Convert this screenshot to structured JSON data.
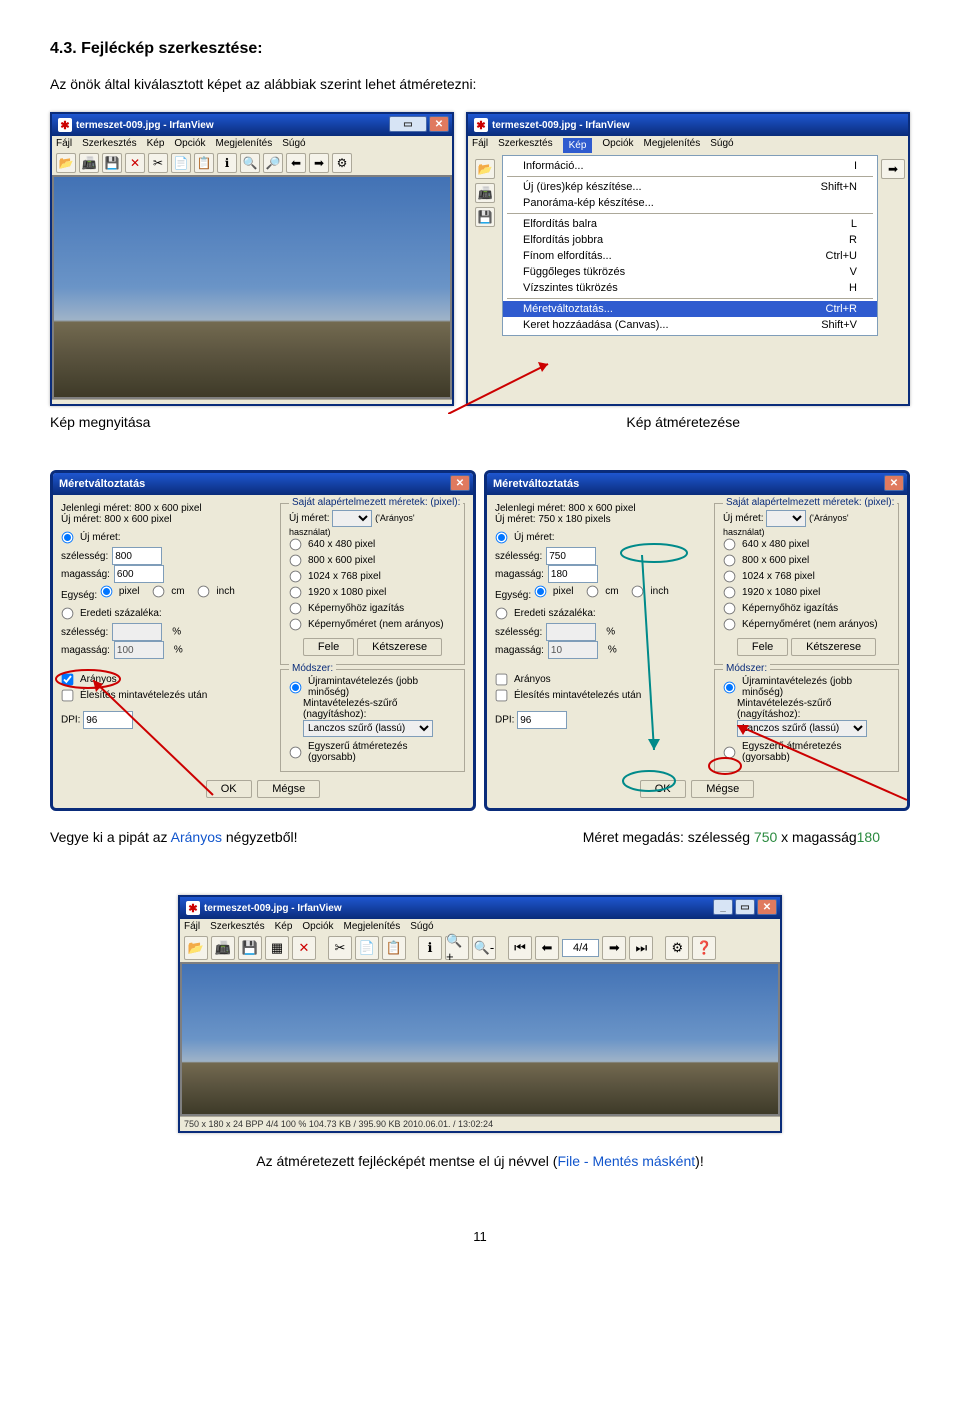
{
  "heading": "4.3.    Fejléckép szerkesztése:",
  "intro": "Az önök által kiválasztott képet az alábbiak szerint lehet átméretezni:",
  "captions": {
    "left1": "Kép megnyitása",
    "right1": "Kép átméretezése",
    "left2_pre": "Vegye ki a pipát az ",
    "left2_blue": "Arányos",
    "left2_post": " négyzetből!",
    "right2_pre": "Méret megadás: szélesség ",
    "right2_green": "750",
    "right2_mid": " x magasság",
    "right2_green2": "180",
    "bottom_pre": "Az átméretezett fejlécképét mentse el új névvel (",
    "bottom_blue": "File - Mentés másként",
    "bottom_post": ")!"
  },
  "irfan": {
    "title": "termeszet-009.jpg - IrfanView",
    "menus": [
      "Fájl",
      "Szerkesztés",
      "Kép",
      "Opciók",
      "Megjelenítés",
      "Súgó"
    ],
    "status_bottom": "750 x 180 x 24 BPP    4/4   100 %     104.73 KB / 395.90 KB 2010.06.01. / 13:02:24",
    "status_top": "  ",
    "nav_label": "4/4"
  },
  "kep_menu": {
    "items": [
      {
        "label": "Információ...",
        "short": "I"
      },
      {
        "sep": true
      },
      {
        "label": "Új (üres)kép készítése...",
        "short": "Shift+N"
      },
      {
        "label": "Panoráma-kép készítése...",
        "short": ""
      },
      {
        "sep": true
      },
      {
        "label": "Elfordítás balra",
        "short": "L"
      },
      {
        "label": "Elfordítás jobbra",
        "short": "R"
      },
      {
        "label": "Fínom elfordítás...",
        "short": "Ctrl+U"
      },
      {
        "label": "Függőleges tükrözés",
        "short": "V"
      },
      {
        "label": "Vízszintes tükrözés",
        "short": "H"
      },
      {
        "sep": true
      },
      {
        "label": "Méretváltoztatás...",
        "short": "Ctrl+R",
        "sel": true
      },
      {
        "label": "Keret hozzáadása (Canvas)...",
        "short": "Shift+V"
      }
    ]
  },
  "dialog": {
    "title": "Méretváltoztatás",
    "current_label": "Jelenlegi méret:",
    "new_label": "Új méret:",
    "presets_legend": "Saját alapértelmezett méretek: (pixel):",
    "new_preset": "Új méret:",
    "aranyos_hint": "('Arányos' használat)",
    "p640": "640 x 480 pixel",
    "p800": "800 x 600 pixel",
    "p1024": "1024 x 768 pixel",
    "p1920": "1920 x 1080 pixel",
    "pscreen": "Képernyőhöz igazítás",
    "psize": "Képernyőméret (nem arányos)",
    "half": "Fele",
    "double": "Kétszerese",
    "method_legend": "Módszer:",
    "m1": "Újramintavételezés (jobb minőség)",
    "m1s": "Mintavételezés-szűrő (nagyításhoz):",
    "m1f": "Lanczos szűrő (lassú)",
    "m2": "Egyszerű átméretezés (gyorsabb)",
    "uj_meret": "Új méret:",
    "sz": "szélesség:",
    "mag": "magasság:",
    "egyseg": "Egység:",
    "u_px": "pixel",
    "u_cm": "cm",
    "u_in": "inch",
    "eredeti": "Eredeti százaléka:",
    "aranyos": "Arányos",
    "eles": "Élesítés mintavételezés után",
    "dpi": "DPI:",
    "ok": "OK",
    "cancel": "Mégse"
  },
  "dlg_left": {
    "current": "800  x  600   pixel",
    "newsize": "800  x  600   pixel",
    "w": "800",
    "h": "600",
    "sw": "",
    "sh": "100",
    "aranyos_checked": true,
    "dpi": "96"
  },
  "dlg_right": {
    "current": "800  x  600   pixel",
    "newsize": "750  x  180   pixels",
    "w": "750",
    "h": "180",
    "sw": "",
    "sh": "10",
    "aranyos_checked": false,
    "dpi": "96"
  },
  "page": "11"
}
